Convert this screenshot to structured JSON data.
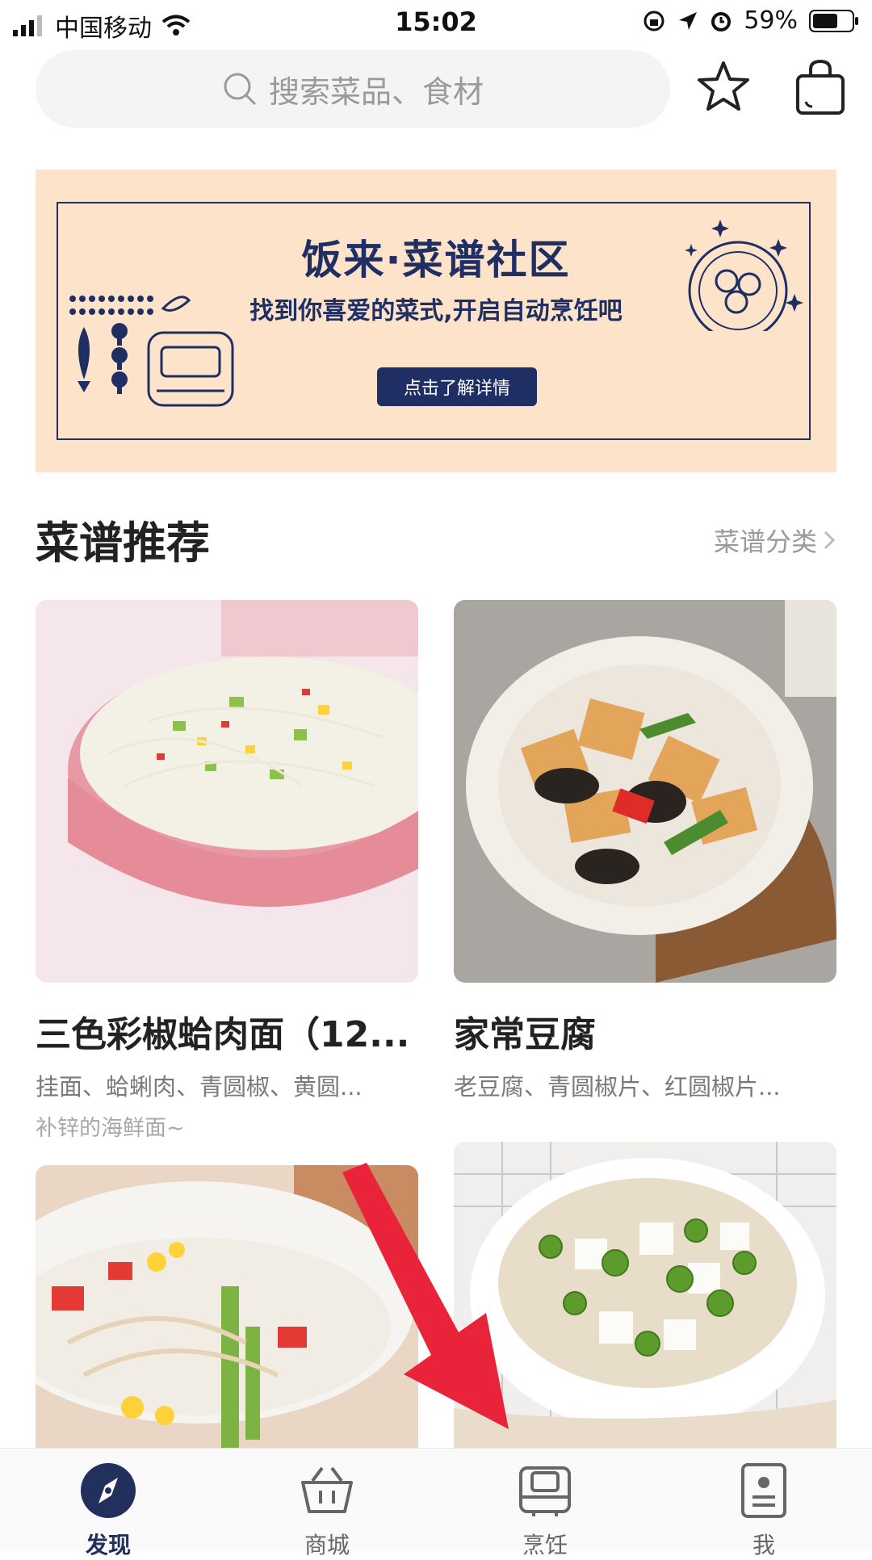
{
  "status_bar": {
    "carrier": "中国移动",
    "time": "15:02",
    "battery": "59%"
  },
  "search": {
    "placeholder": "搜索菜品、食材"
  },
  "banner": {
    "title": "饭来·菜谱社区",
    "subtitle": "找到你喜爱的菜式,开启自动烹饪吧",
    "button": "点击了解详情"
  },
  "section": {
    "title": "菜谱推荐",
    "link": "菜谱分类"
  },
  "recipes": [
    {
      "title": "三色彩椒蛤肉面（12...",
      "ingredients": "挂面、蛤蜊肉、青圆椒、黄圆...",
      "description": "补锌的海鲜面~"
    },
    {
      "title": "家常豆腐",
      "ingredients": "老豆腐、青圆椒片、红圆椒片...",
      "description": ""
    }
  ],
  "tabs": [
    {
      "label": "发现",
      "active": true
    },
    {
      "label": "商城",
      "active": false
    },
    {
      "label": "烹饪",
      "active": false
    },
    {
      "label": "我",
      "active": false
    }
  ],
  "colors": {
    "brand": "#22305e",
    "banner_bg": "#fde3ca",
    "arrow": "#e8233a"
  }
}
